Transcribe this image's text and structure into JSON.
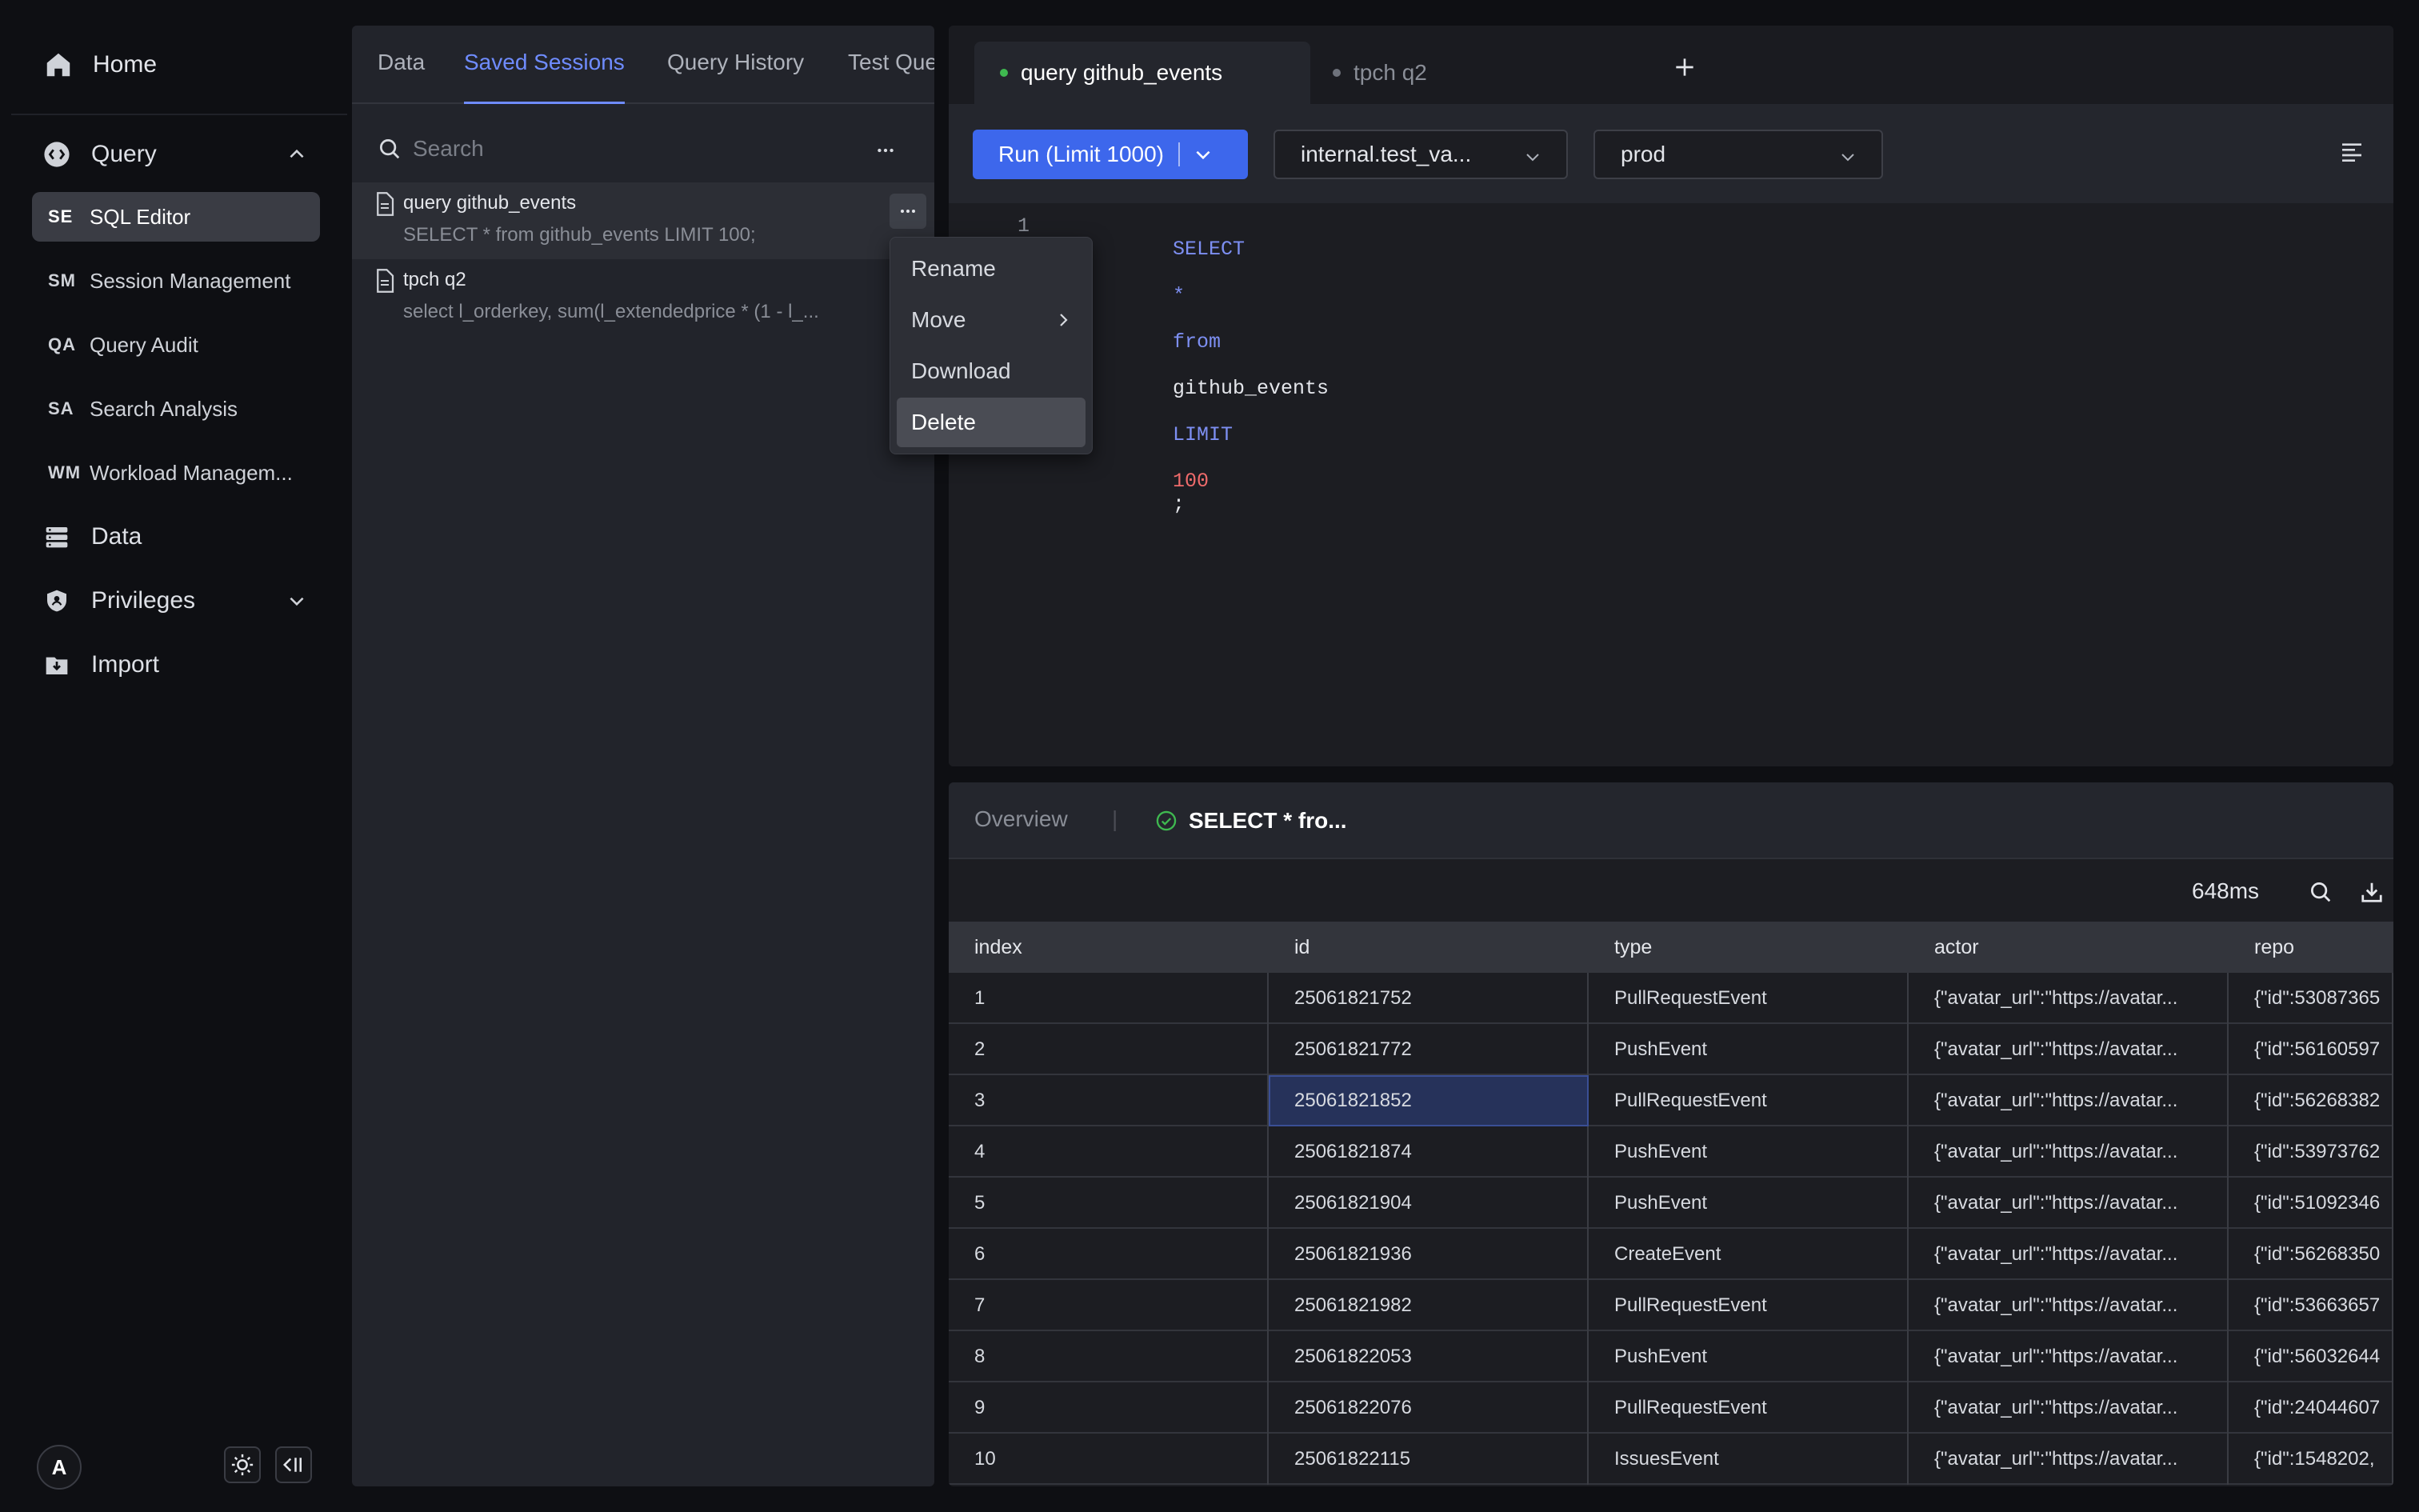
{
  "nav": {
    "home": "Home",
    "query": "Query",
    "sub_items": [
      {
        "abbr": "SE",
        "label": "SQL Editor"
      },
      {
        "abbr": "SM",
        "label": "Session Management"
      },
      {
        "abbr": "QA",
        "label": "Query Audit"
      },
      {
        "abbr": "SA",
        "label": "Search Analysis"
      },
      {
        "abbr": "WM",
        "label": "Workload Managem..."
      }
    ],
    "data": "Data",
    "privileges": "Privileges",
    "import": "Import",
    "avatar": "A"
  },
  "sessions_panel": {
    "tabs": [
      "Data",
      "Saved Sessions",
      "Query History",
      "Test Que"
    ],
    "active_tab": "Saved Sessions",
    "search_placeholder": "Search",
    "items": [
      {
        "title": "query github_events",
        "preview": "SELECT * from github_events LIMIT 100;"
      },
      {
        "title": "tpch q2",
        "preview": "select l_orderkey, sum(l_extendedprice * (1 - l_..."
      }
    ]
  },
  "context_menu": {
    "items": [
      "Rename",
      "Move",
      "Download",
      "Delete"
    ],
    "selected": "Delete"
  },
  "editor": {
    "tabs": [
      {
        "label": "query github_events",
        "status_color": "#3fb950",
        "active": true
      },
      {
        "label": "tpch q2",
        "status_color": "#6e727b",
        "active": false
      }
    ],
    "run_label": "Run (Limit 1000)",
    "catalog_select": "internal.test_va...",
    "env_select": "prod",
    "code": {
      "line_number": "1",
      "select": "SELECT",
      "star": "*",
      "from": "from",
      "table": "github_events",
      "limit": "LIMIT",
      "limit_value": "100",
      "end": ";"
    }
  },
  "results": {
    "tabs": {
      "overview": "Overview",
      "query": "SELECT * fro..."
    },
    "elapsed": "648ms",
    "columns": [
      "index",
      "id",
      "type",
      "actor",
      "repo"
    ],
    "rows": [
      [
        "1",
        "25061821752",
        "PullRequestEvent",
        "{\"avatar_url\":\"https://avatar...",
        "{\"id\":53087365"
      ],
      [
        "2",
        "25061821772",
        "PushEvent",
        "{\"avatar_url\":\"https://avatar...",
        "{\"id\":56160597"
      ],
      [
        "3",
        "25061821852",
        "PullRequestEvent",
        "{\"avatar_url\":\"https://avatar...",
        "{\"id\":56268382"
      ],
      [
        "4",
        "25061821874",
        "PushEvent",
        "{\"avatar_url\":\"https://avatar...",
        "{\"id\":53973762"
      ],
      [
        "5",
        "25061821904",
        "PushEvent",
        "{\"avatar_url\":\"https://avatar...",
        "{\"id\":51092346"
      ],
      [
        "6",
        "25061821936",
        "CreateEvent",
        "{\"avatar_url\":\"https://avatar...",
        "{\"id\":56268350"
      ],
      [
        "7",
        "25061821982",
        "PullRequestEvent",
        "{\"avatar_url\":\"https://avatar...",
        "{\"id\":53663657"
      ],
      [
        "8",
        "25061822053",
        "PushEvent",
        "{\"avatar_url\":\"https://avatar...",
        "{\"id\":56032644"
      ],
      [
        "9",
        "25061822076",
        "PullRequestEvent",
        "{\"avatar_url\":\"https://avatar...",
        "{\"id\":24044607"
      ],
      [
        "10",
        "25061822115",
        "IssuesEvent",
        "{\"avatar_url\":\"https://avatar...",
        "{\"id\":1548202,"
      ]
    ],
    "selected_cell": {
      "row": 3,
      "col": "id"
    }
  }
}
